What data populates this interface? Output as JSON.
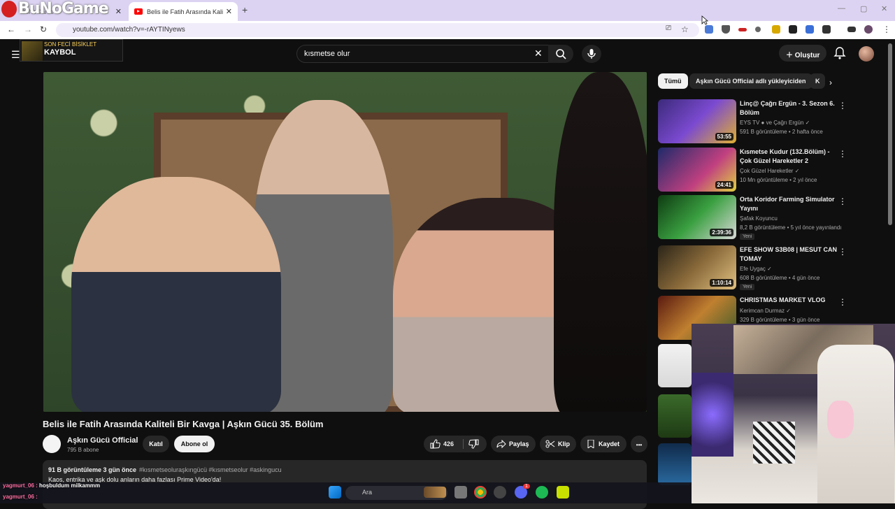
{
  "browser": {
    "tabs": [
      {
        "title": "BuNoGame"
      },
      {
        "title": "Belis ile Fatih Arasında Kaliteli Bir Kavga"
      }
    ],
    "url": "youtube.com/watch?v=-rAYTINyews",
    "new_tab": "+",
    "close_glyph": "✕"
  },
  "stream_overlay": {
    "logo_text": "BuNoGame",
    "now_playing_top": "SON FECİ BİSİKLET",
    "now_playing_title": "KAYBOL"
  },
  "youtube": {
    "search_value": "kısmetse olur",
    "create_label": "Oluştur",
    "video": {
      "title": "Belis ile Fatih Arasında Kaliteli Bir Kavga | Aşkın Gücü 35. Bölüm",
      "channel": "Aşkın Gücü Official",
      "subscribers": "795 B abone",
      "join_label": "Katıl",
      "subscribe_label": "Abone ol",
      "likes": "426",
      "share_label": "Paylaş",
      "clip_label": "Klip",
      "save_label": "Kaydet",
      "more_label": "•••",
      "views_date": "91 B görüntüleme  3 gün önce",
      "hashtags": "#kısmetseoluraşkıngücü #kısmetseolur #askingucu",
      "description": "Kaos, entrika ve aşk dolu anların daha fazlası Prime Video'da!"
    },
    "chips": [
      {
        "label": "Tümü"
      },
      {
        "label": "Aşkın Gücü Official adlı yükleyiciden"
      },
      {
        "label": "K"
      }
    ],
    "recommendations": [
      {
        "title": "Linç@ Çağrı Ergün - 3. Sezon 6. Bölüm",
        "channel": "EYS TV ● ve Çağrı Ergün ✓",
        "meta": "591 B görüntüleme • 2 hafta önce",
        "duration": "53:55",
        "badge": ""
      },
      {
        "title": "Kısmetse Kudur (132.Bölüm) - Çok Güzel Hareketler 2",
        "channel": "Çok Güzel Hareketler ✓",
        "meta": "10 Mn görüntüleme • 2 yıl önce",
        "duration": "24:41",
        "badge": ""
      },
      {
        "title": "Orta Koridor Farming Simulator Yayını",
        "channel": "Şafak Koyuncu",
        "meta": "8,2 B görüntüleme • 5 yıl önce yayınlandı",
        "duration": "2:39:36",
        "badge": "Yeni"
      },
      {
        "title": "EFE SHOW S3B08 | MESUT CAN TOMAY",
        "channel": "Efe Uygaç ✓",
        "meta": "608 B görüntüleme • 4 gün önce",
        "duration": "1:10:14",
        "badge": "Yeni"
      },
      {
        "title": "CHRISTMAS MARKET VLOG",
        "channel": "Kerimcan Durmaz ✓",
        "meta": "329 B görüntüleme • 3 gün önce",
        "duration": "",
        "badge": ""
      }
    ]
  },
  "taskbar": {
    "search_placeholder": "Ara",
    "notification_count": "1"
  },
  "chat": {
    "line1_user": "yagmurt_06 :",
    "line1_msg": "hoşbuldum milkammm",
    "line2_user": "yagmurt_06 :"
  },
  "colors": {
    "yt_bg": "#0f0f0f",
    "chip_active": "#f1f1f1",
    "yt_red": "#ff0000"
  }
}
